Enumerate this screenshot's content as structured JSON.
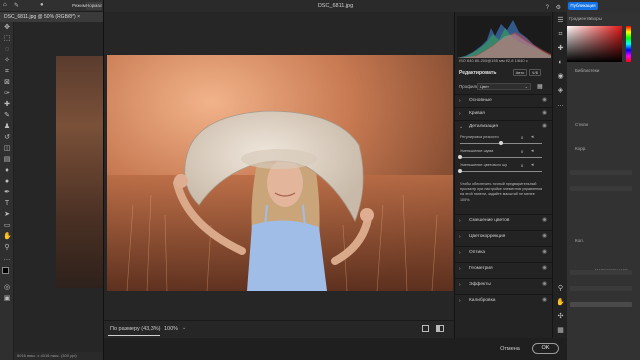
{
  "photoshop": {
    "menu_items": [
      "Режим",
      "Нормаль"
    ],
    "doc_tab": "DSC_6811.jpg @ 50% (RGB/8*) ×",
    "status_bar": "6016 пикс. x 4016 пикс. (300 ppi)",
    "publish_button": "Публикация",
    "right_tabs": [
      "Градиенты",
      "Узоры"
    ],
    "right_panel_texts": [
      "Библиотеки",
      "Стили",
      "Корр.",
      "Кол.",
      "Непрозрачность"
    ]
  },
  "camera_raw": {
    "title": "DSC_6811.jpg",
    "help_icon": "?",
    "settings_icon": "gear-icon",
    "fit_label": "По размеру (43,3%)",
    "zoom_label": "100%",
    "cancel_label": "Отмена",
    "ok_label": "OK",
    "exif": "ISO 640   80-200@155 мм   f/2,8   1/640 с",
    "edit_title": "Редактировать",
    "auto_label": "Авто",
    "bw_label": "Ч/Б",
    "profile_label": "Профиль",
    "profile_value": "Цвет",
    "sections": [
      {
        "label": "Основные",
        "expanded": false
      },
      {
        "label": "Кривая",
        "expanded": false
      },
      {
        "label": "Детализация",
        "expanded": true
      },
      {
        "label": "Смешение цветов",
        "expanded": false
      },
      {
        "label": "Цветокоррекция",
        "expanded": false
      },
      {
        "label": "Оптика",
        "expanded": false
      },
      {
        "label": "Геометрия",
        "expanded": false
      },
      {
        "label": "Эффекты",
        "expanded": false
      },
      {
        "label": "Калибровка",
        "expanded": false
      }
    ],
    "detail_sliders": [
      {
        "label": "Регулировка резкости",
        "value": "0",
        "position": 0.5
      },
      {
        "label": "Уменьшение шума",
        "value": "0",
        "position": 0.0
      },
      {
        "label": "Уменьшение цветового шу",
        "value": "0",
        "position": 0.0
      }
    ],
    "detail_note": "Чтобы обеспечить точный предварительный просмотр при настройке элементов управления на этой панели, задайте масштаб не менее 100%."
  },
  "colors": {
    "accent": "#1473e6",
    "dialog_bg": "#1f1f1f",
    "panel_bg": "#232323"
  }
}
